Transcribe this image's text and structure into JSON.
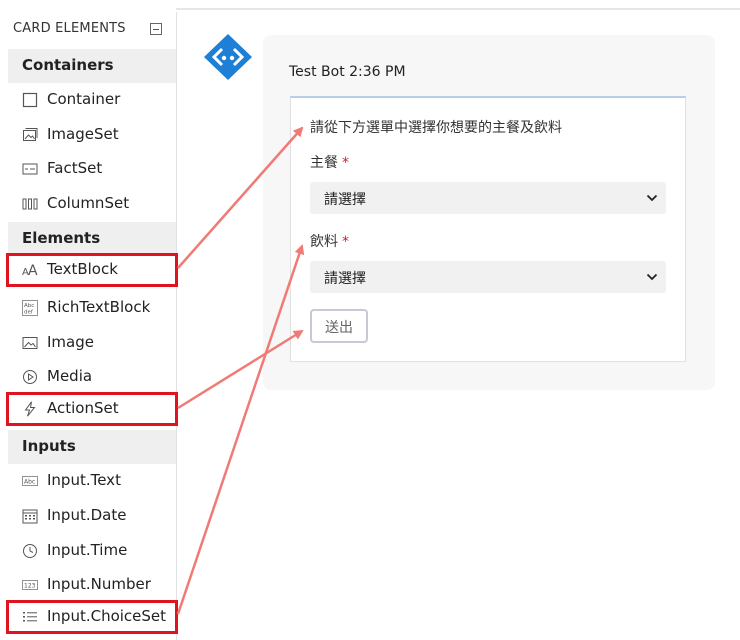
{
  "sidebar": {
    "title": "CARD ELEMENTS",
    "sections": {
      "containers": "Containers",
      "elements": "Elements",
      "inputs": "Inputs"
    },
    "items": [
      {
        "label": "Container",
        "icon": "container-icon"
      },
      {
        "label": "ImageSet",
        "icon": "imageset-icon"
      },
      {
        "label": "FactSet",
        "icon": "factset-icon"
      },
      {
        "label": "ColumnSet",
        "icon": "columnset-icon"
      },
      {
        "label": "TextBlock",
        "icon": "textblock-icon"
      },
      {
        "label": "RichTextBlock",
        "icon": "richtextblock-icon"
      },
      {
        "label": "Image",
        "icon": "image-icon"
      },
      {
        "label": "Media",
        "icon": "media-icon"
      },
      {
        "label": "ActionSet",
        "icon": "lightning-icon"
      },
      {
        "label": "Input.Text",
        "icon": "input-text-icon"
      },
      {
        "label": "Input.Date",
        "icon": "calendar-icon"
      },
      {
        "label": "Input.Time",
        "icon": "clock-icon"
      },
      {
        "label": "Input.Number",
        "icon": "number-icon"
      },
      {
        "label": "Input.ChoiceSet",
        "icon": "list-icon"
      }
    ]
  },
  "bot": {
    "header": "Test Bot 2:36 PM",
    "card": {
      "text": "請從下方選單中選擇你想要的主餐及飲料",
      "main_label": "主餐",
      "drink_label": "飲料",
      "required_mark": "*",
      "main_select": "請選擇",
      "drink_select": "請選擇",
      "submit": "送出"
    }
  },
  "colors": {
    "highlight_border": "#e0141e",
    "arrow": "#f07a76",
    "bot_avatar": "#1e7fd6"
  }
}
